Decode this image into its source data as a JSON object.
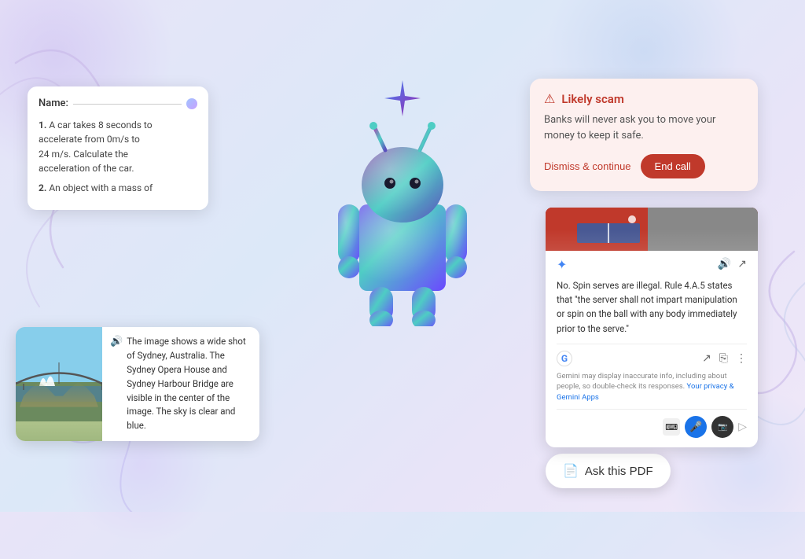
{
  "background": {
    "colors": [
      "#e8e4f8",
      "#dce8f8"
    ]
  },
  "worksheet_card": {
    "name_label": "Name:",
    "questions": [
      "1.  A car takes 8 seconds to accelerate from 0m/s to 24 m/s. Calculate the acceleration of the car.",
      "2.  An object with a mass of"
    ]
  },
  "sydney_card": {
    "description": "The image shows a wide shot of Sydney, Australia. The Sydney Opera House and Sydney Harbour Bridge are visible in the center of the image. The sky is clear and blue."
  },
  "scam_card": {
    "title": "Likely scam",
    "warning_icon": "⚠",
    "body": "Banks will never ask you to move your money to keep it safe.",
    "dismiss_label": "Dismiss & continue",
    "end_call_label": "End call"
  },
  "spin_card": {
    "rule_text": "No. Spin serves are illegal. Rule 4.A.5 states that \"the server shall not impart manipulation or spin on the ball with any body immediately prior to the serve.\"",
    "footer_text": "Gemini may display inaccurate info, including about people, so double-check its responses.",
    "footer_link": "Your privacy & Gemini Apps"
  },
  "ask_pdf_button": {
    "label": "Ask this PDF",
    "icon": "PDF"
  },
  "android": {
    "sparkle": "✦"
  }
}
